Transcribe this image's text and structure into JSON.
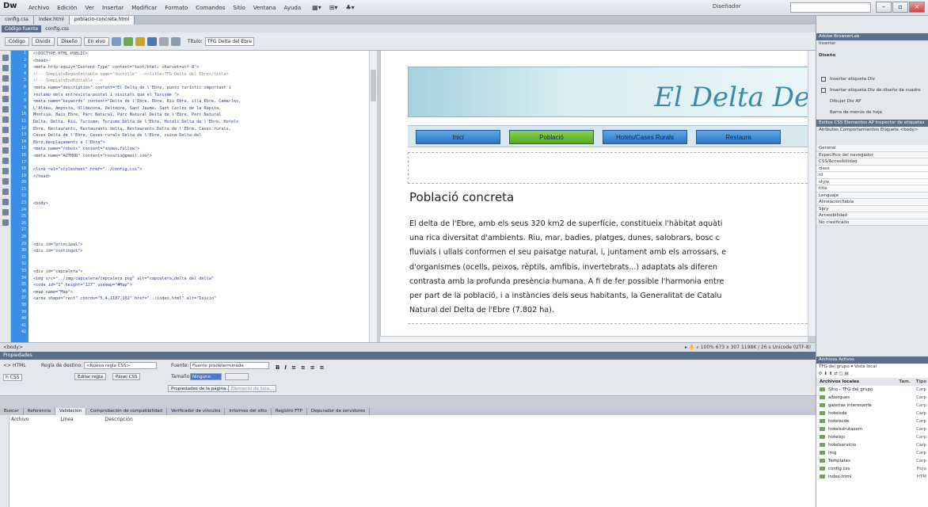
{
  "app": {
    "logo": "Dw",
    "menus": [
      "Archivo",
      "Edición",
      "Ver",
      "Insertar",
      "Modificar",
      "Formato",
      "Comandos",
      "Sitio",
      "Ventana",
      "Ayuda"
    ],
    "workspace": "Diseñador",
    "search_placeholder": ""
  },
  "doc_tabs": [
    "config.css",
    "index.html",
    "poblacio-concreta.html"
  ],
  "related": {
    "source": "Código fuente",
    "file": "config.css",
    "path": ""
  },
  "toolbar": {
    "views": [
      "Código",
      "Dividir",
      "Diseño",
      "En vivo"
    ],
    "title_label": "Título:",
    "title_value": "TFG Delta del Ebre"
  },
  "line_numbers": [
    "1",
    "2",
    "3",
    "4",
    "5",
    "6",
    "7",
    "8",
    "9",
    "10",
    "11",
    "12",
    "13",
    "14",
    "15",
    "16",
    "17",
    "18",
    "19",
    "20",
    "21",
    "22",
    "23",
    "24",
    "25",
    "26",
    "27",
    "28",
    "29",
    "30",
    "31",
    "32",
    "33",
    "34",
    "35",
    "36",
    "37",
    "38",
    "39",
    "40",
    "41",
    "42"
  ],
  "code_lines": [
    "<!DOCTYPE HTML PUBLIC>",
    "<head>",
    "<meta http-equiv=\"Content-Type\" content=\"text/html; charset=utf-8\">",
    "<!-- TemplateBeginEditable name=\"doctitle\" --><title>TFG Delta del Ebre</title>",
    "<!-- TemplateEndEditable -->",
    "<meta name=\"description\" content=\"El Delta de l'Ebre, punto turístic important i",
    "reclamo dels entrevista postal i visitats que el Turisme \">",
    "<meta name=\"keywords\" content=\"Delta de l'Ebre, Ebre, Riu Ebre, illa Ebre, Camarles,",
    " L'Aldea, Amposta, Ulldecona, Deltebre, Sant Jaume, Sant Carles de la Ràpita,",
    "Montsià, Baix Ebre, Parc Natural, Parc Natural Delta de l'Ebre, Parc Natural",
    "Delta, Delta, Riu, Turisme, Turisme Delta de l'Ebre, Hotels Delta de l'Ebre, Hotels",
    " Ebre, Restaurants, Restaurants delta, Restaurants Delta de l'Ebre, Cases rurals,",
    "Cases Delta de l'Ebre, Cases rurals Delta de l'Ebre, cuina Delta del",
    "Ebre,desplaçaments a l'Ebre\">",
    "<meta name=\"robots\" content=\"index,follow\">",
    "<meta name=\"AUTHOR\" content=\"rosario@gmail.com\">",
    "",
    "<link rel=\"stylesheet\" href=\"../config.css\">",
    "</head>",
    "",
    "",
    "",
    "<body>",
    "",
    "",
    "",
    "",
    "",
    "<div id=\"principal\">",
    "      <div id=\"contingut\">",
    "",
    "",
    "        <div id=\"capcalera\">",
    "        <img src=\"../img/capcalera/capcalera.png\" alt=\"capcalera,delta del delta\"",
    "<code id=\"1\" height=\"127\" usemap=\"#Map\">",
    "        <map name=\"Map\">",
    "          <area shape=\"rect\" coords=\"5,4,1187,102\" href=\"../index.html\" alt=\"Inicio\""
  ],
  "design": {
    "banner_title": "El Delta Del",
    "nav": [
      "Inici",
      "Població",
      "Hotels/Cases Rurals",
      "Restaura"
    ],
    "nav_active": 1,
    "page_title": "Població concreta",
    "body_lines": [
      "El delta de l'Ebre, amb els seus 320 km2 de superfície, constitueix l'hàbitat aquàti",
      "una rica diversitat d'ambients. Riu, mar, badies, platges, dunes, salobrars, bosc c",
      "fluvials i ullals conformen el seu paisatge natural, i, juntament amb els arrossars, e",
      "d'organismes (ocells, peixos, rèptils, amfibis, invertebrats...) adaptats als diferen",
      "contrasta amb la profunda presència humana. A fi de fer possible l'harmonia entre",
      "per part de la població, i a instàncies dels seus habitants, la Generalitat de Catalu",
      "Natural del Delta de l'Ebre (7.802 ha)."
    ]
  },
  "status": {
    "tag": "<body>",
    "zoom": "100%",
    "size": "673 x 307",
    "info": "1198K / 26 s Unicode (UTF-8)"
  },
  "properties": {
    "title": "Propiedades",
    "html_label": "<> HTML",
    "css_label": "h CSS",
    "rule_label": "Regla de destino:",
    "rule_value": "<Nueva regla CSS>",
    "edit_rule": "Editar regla",
    "css_panel": "Panel CSS",
    "font_label": "Fuente:",
    "font_value": "Fuente predeterminada",
    "size_label": "Tamaño:",
    "size_value": "Ninguno",
    "page_props": "Propiedades de la página...",
    "list_item": "Elemento de lista..."
  },
  "results": {
    "tabs": [
      "Buscar",
      "Referencia",
      "Validación",
      "Comprobación de compatibilidad",
      "Verificador de vínculos",
      "Informes del sitio",
      "Registro FTP",
      "Depurador de servidores"
    ],
    "active_tab": 2,
    "headers": [
      "Archivo",
      "Línea",
      "Descripción"
    ]
  },
  "right_panel": {
    "insert_header": "Adobe BrowserLab",
    "insert_tab": "Insertar",
    "insert_category": "Diseño",
    "insert_items": [
      "Insertar etiqueta Div",
      "Insertar etiqueta Div de diseño de cuadro",
      "Dibujar Div AP",
      "Barra de menús de hoja"
    ],
    "css_header": "Estilos CSS  Elementos AP  Inspector de etiquetas",
    "css_tabs": "Atributos  Comportamientos  Etiqueta <body>",
    "css_rows": [
      "General",
      "Específico del navegador",
      "CSS/Accesibilidad",
      "class",
      "id",
      "style",
      "title",
      "Lenguaje",
      "Alineación/tabla",
      "Spry",
      "Accesibilidad",
      "No clasificado"
    ],
    "files_header": "Archivos  Activos",
    "files_site": "TFG del grupo",
    "files_view": "Vista local",
    "files_cols": [
      "Archivos locales",
      "Tam.",
      "Tipo"
    ],
    "files": [
      {
        "name": "Sitio - TFG del grupo",
        "type": "Carp"
      },
      {
        "name": "albergues",
        "type": "Carp"
      },
      {
        "name": "galerias interesante",
        "type": "Carp"
      },
      {
        "name": "hotelsde",
        "type": "Carp"
      },
      {
        "name": "hotelscde",
        "type": "Carp"
      },
      {
        "name": "hotelsdrutasem",
        "type": "Carp"
      },
      {
        "name": "hotelsjc",
        "type": "Carp"
      },
      {
        "name": "hotelservicio",
        "type": "Carp"
      },
      {
        "name": "img",
        "type": "Carp"
      },
      {
        "name": "Templates",
        "type": "Carp"
      },
      {
        "name": "config.css",
        "type": "Hoja"
      },
      {
        "name": "index.html",
        "type": "HTM"
      }
    ]
  }
}
